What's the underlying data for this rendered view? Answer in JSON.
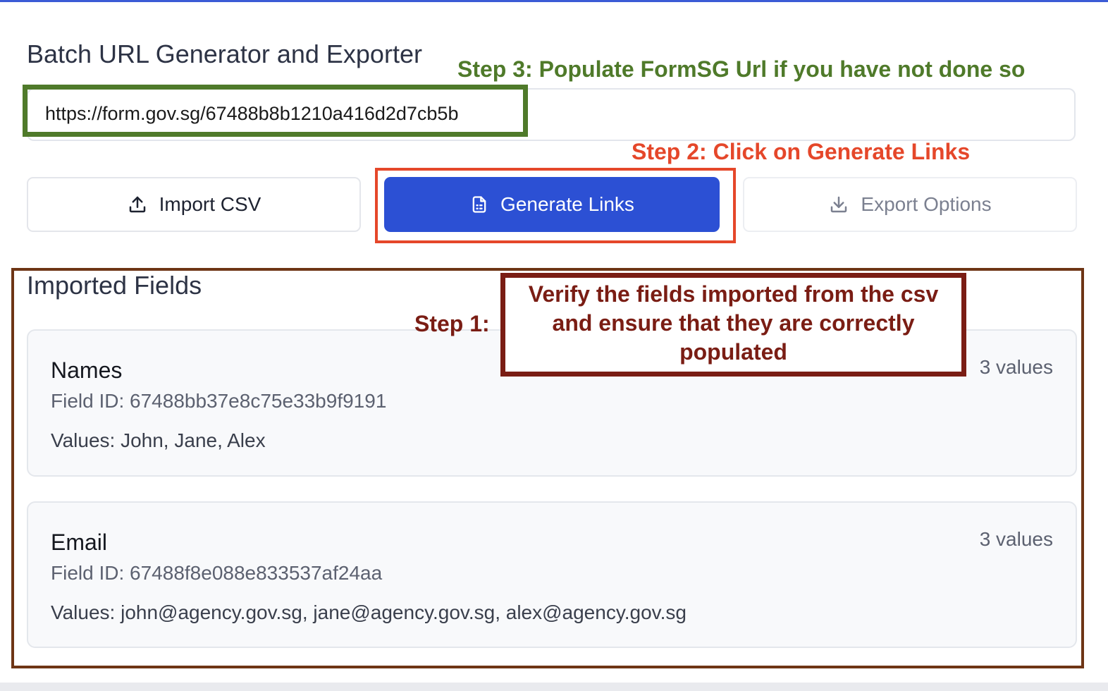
{
  "header": {
    "title": "Batch URL Generator and Exporter"
  },
  "url_input": {
    "value": "https://form.gov.sg/67488b8b1210a416d2d7cb5b"
  },
  "actions": {
    "import_label": "Import CSV",
    "generate_label": "Generate Links",
    "export_label": "Export Options"
  },
  "imported_fields": {
    "heading": "Imported Fields",
    "fields": [
      {
        "name": "Names",
        "field_id": "Field ID: 67488bb37e8c75e33b9f9191",
        "values": "Values: John, Jane, Alex",
        "count": "3 values"
      },
      {
        "name": "Email",
        "field_id": "Field ID: 67488f8e088e833537af24aa",
        "values": "Values: john@agency.gov.sg, jane@agency.gov.sg, alex@agency.gov.sg",
        "count": "3 values"
      }
    ]
  },
  "annotations": {
    "step3": "Step 3: Populate FormSG Url if you have not done so",
    "step2": "Step 2: Click on Generate Links",
    "step1": "Step 1:",
    "step1_detail": "Verify the fields imported from the csv and ensure that they are correctly populated"
  },
  "colors": {
    "primary": "#2c50d4",
    "annotation_green": "#4f7a2a",
    "annotation_red": "#e5472a",
    "annotation_brown": "#6e3515",
    "annotation_maroon": "#7a1d14"
  },
  "icons": {
    "import": "upload-icon",
    "generate": "document-icon",
    "export": "download-icon"
  }
}
